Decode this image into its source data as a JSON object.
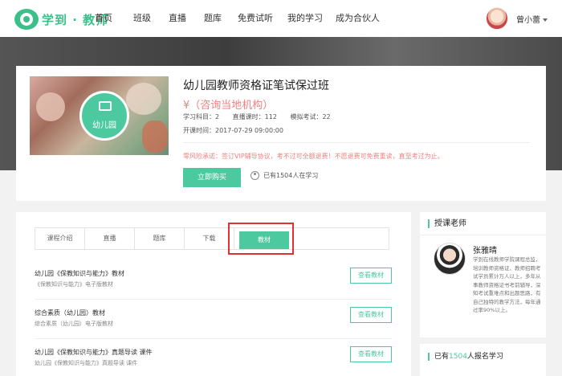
{
  "brand": {
    "logo_text": "学到 · 教师",
    "accent": "#4dc9a0",
    "alert_color": "#f28080"
  },
  "nav": {
    "items": [
      "首页",
      "班级",
      "直播",
      "题库",
      "免费试听",
      "我的学习",
      "成为合伙人"
    ],
    "user_name": "曾小蕾"
  },
  "course": {
    "image_label": "幼儿园",
    "title": "幼儿园教师资格证笔试保过班",
    "price": "¥（咨询当地机构）",
    "subjects": "学习科目：2",
    "live_hours": "直播课时：112",
    "mock_exams": "模拟考试：22",
    "start_time": "开课时间：2017-07-29 09:00:00",
    "notice": "零风险承诺：签订VIP辅导协议，考不过可全额退费！不愿退费可免费重读，直至考过为止。",
    "buy_label": "立即购买",
    "learners_text": "已有1504人在学习"
  },
  "tabs": [
    "课程介绍",
    "直播",
    "题库",
    "下载",
    "教材"
  ],
  "materials": [
    {
      "title": "幼儿园《保教知识与能力》教材",
      "subtitle": "《保教知识与能力》电子版教材",
      "button": "查看教材"
    },
    {
      "title": "综合素质（幼儿园）教材",
      "subtitle": "综合素质（幼儿园）电子版教材",
      "button": "查看教材"
    },
    {
      "title": "幼儿园《保教知识与能力》真题导读 课件",
      "subtitle": "幼儿园《保教知识与能力》真题导读 课件",
      "button": "查看教材"
    }
  ],
  "teacher": {
    "section_title": "授课老师",
    "name": "张雅晴",
    "bio": "学到在线教师学院课程总监，培训教师资格证、教师招聘考试学员累计万人以上，多年从事教师资格证书考前辅导，深知考试重难点和出题思路，有自己独特的教学方法，每年通过率90%以上。"
  },
  "signup": {
    "prefix": "已有",
    "count": "1504",
    "suffix": "人报名学习"
  }
}
